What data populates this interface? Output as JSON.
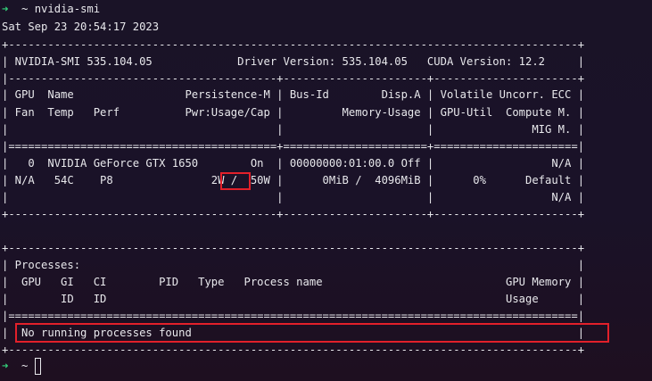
{
  "prompt": {
    "arrow": "➜",
    "cwd": "~",
    "command": "nvidia-smi"
  },
  "timestamp": "Sat Sep 23 20:54:17 2023",
  "table": {
    "border_top": "+---------------------------------------------------------------------------------------+",
    "header": "| NVIDIA-SMI 535.104.05             Driver Version: 535.104.05   CUDA Version: 12.2     |",
    "sep_1": "|-----------------------------------------+----------------------+----------------------+",
    "cols_1": "| GPU  Name                 Persistence-M | Bus-Id        Disp.A | Volatile Uncorr. ECC |",
    "cols_2": "| Fan  Temp   Perf          Pwr:Usage/Cap |         Memory-Usage | GPU-Util  Compute M. |",
    "cols_3": "|                                         |                      |               MIG M. |",
    "sep_2": "|=========================================+======================+======================|",
    "gpu_row_1": "|   0  NVIDIA GeForce GTX 1650        On  | 00000000:01:00.0 Off |                  N/A |",
    "gpu_row_2": "| N/A   54C    P8               2W /  50W |      0MiB /  4096MiB |      0%      Default |",
    "gpu_row_3": "|                                         |                      |                  N/A |",
    "border_mid": "+-----------------------------------------+----------------------+----------------------+",
    "blank": "",
    "proc_top": "+---------------------------------------------------------------------------------------+",
    "proc_title": "| Processes:                                                                            |",
    "proc_cols_1": "|  GPU   GI   CI        PID   Type   Process name                            GPU Memory |",
    "proc_cols_2": "|        ID   ID                                                             Usage      |",
    "proc_sep": "|=======================================================================================|",
    "proc_row": "|  No running processes found                                                           |",
    "proc_bottom": "+---------------------------------------------------------------------------------------+"
  },
  "power_usage": "2W",
  "no_processes_message": "No running processes found",
  "prompt2": {
    "arrow": "➜",
    "cwd": "~"
  },
  "colors": {
    "background": "#1a1327",
    "prompt_arrow": "#33d27a",
    "text": "#e8e8ec",
    "highlight": "#e2202a"
  }
}
